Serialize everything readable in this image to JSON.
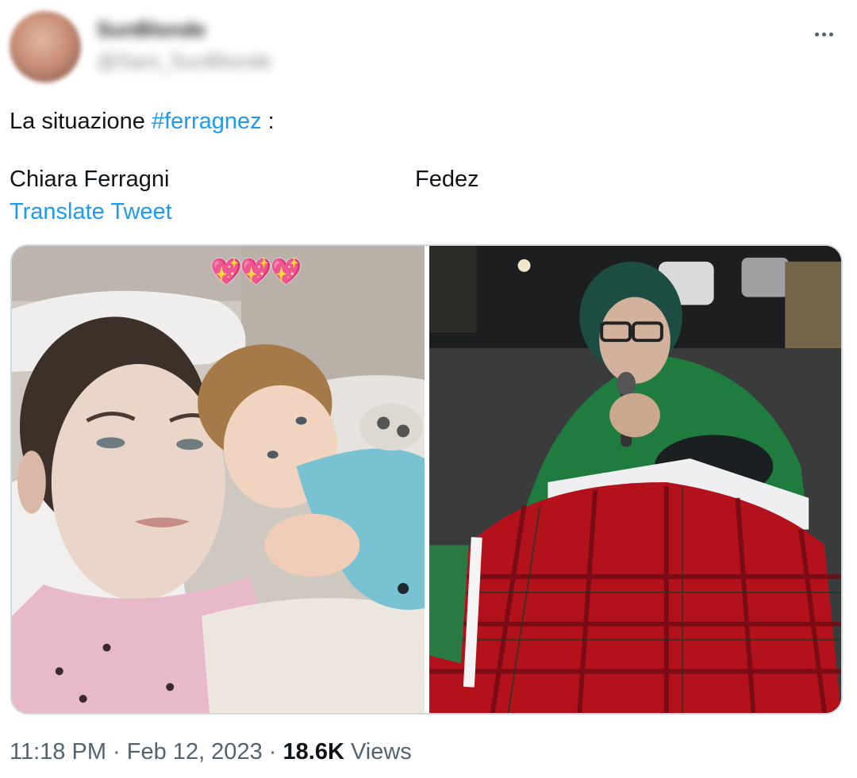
{
  "author": {
    "display_name": "SunBlonde",
    "handle": "@Sani_SunBlonde",
    "avatar_icon": "profile-avatar"
  },
  "more_icon": "ellipsis-icon",
  "text": {
    "prefix": "La situazione ",
    "hashtag": "#ferragnez",
    "suffix": " :",
    "left_caption": "Chiara Ferragni",
    "right_caption": "Fedez"
  },
  "translate_label": "Translate Tweet",
  "media": {
    "left_overlay": "💖💖💖",
    "left_alt": "selfie-photo",
    "right_alt": "street-night-photo"
  },
  "footer": {
    "time": "11:18 PM",
    "separator": "·",
    "date": "Feb 12, 2023",
    "views_count": "18.6K",
    "views_label": "Views"
  },
  "colors": {
    "link": "#1d9bf0",
    "secondary_text": "#536471",
    "border": "#cfd9de"
  }
}
